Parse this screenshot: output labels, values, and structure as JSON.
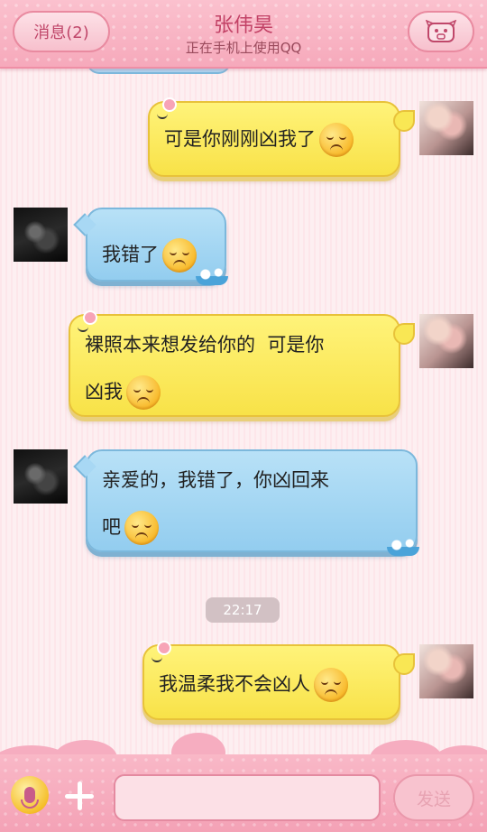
{
  "header": {
    "back_label": "消息(2)",
    "contact_name": "张伟昊",
    "status": "正在手机上使用QQ",
    "profile_icon": "pig-face-icon"
  },
  "messages": [
    {
      "from": "me",
      "text": "可是你刚刚凶我了",
      "emoji": "sad-face-icon"
    },
    {
      "from": "contact",
      "text": "我错了",
      "emoji": "embarrassed-face-icon"
    },
    {
      "from": "me",
      "text_line1": "裸照本来想发给你的  可是你",
      "text_line2": "凶我",
      "emoji": "sad-face-icon"
    },
    {
      "from": "contact",
      "text_line1": "亲爱的，我错了，你凶回来",
      "text_line2": "吧",
      "emoji": "sad-face-icon"
    },
    {
      "from": "me",
      "text": "我温柔我不会凶人",
      "emoji": "sad-face-icon"
    }
  ],
  "timestamp": "22:17",
  "composer": {
    "mic_icon": "microphone-icon",
    "plus_icon": "plus-icon",
    "placeholder": "",
    "send_label": "发送"
  },
  "colors": {
    "header": "#f6a9bb",
    "my_bubble": "#f8e248",
    "their_bubble": "#93cdef",
    "title_text": "#c24266"
  }
}
